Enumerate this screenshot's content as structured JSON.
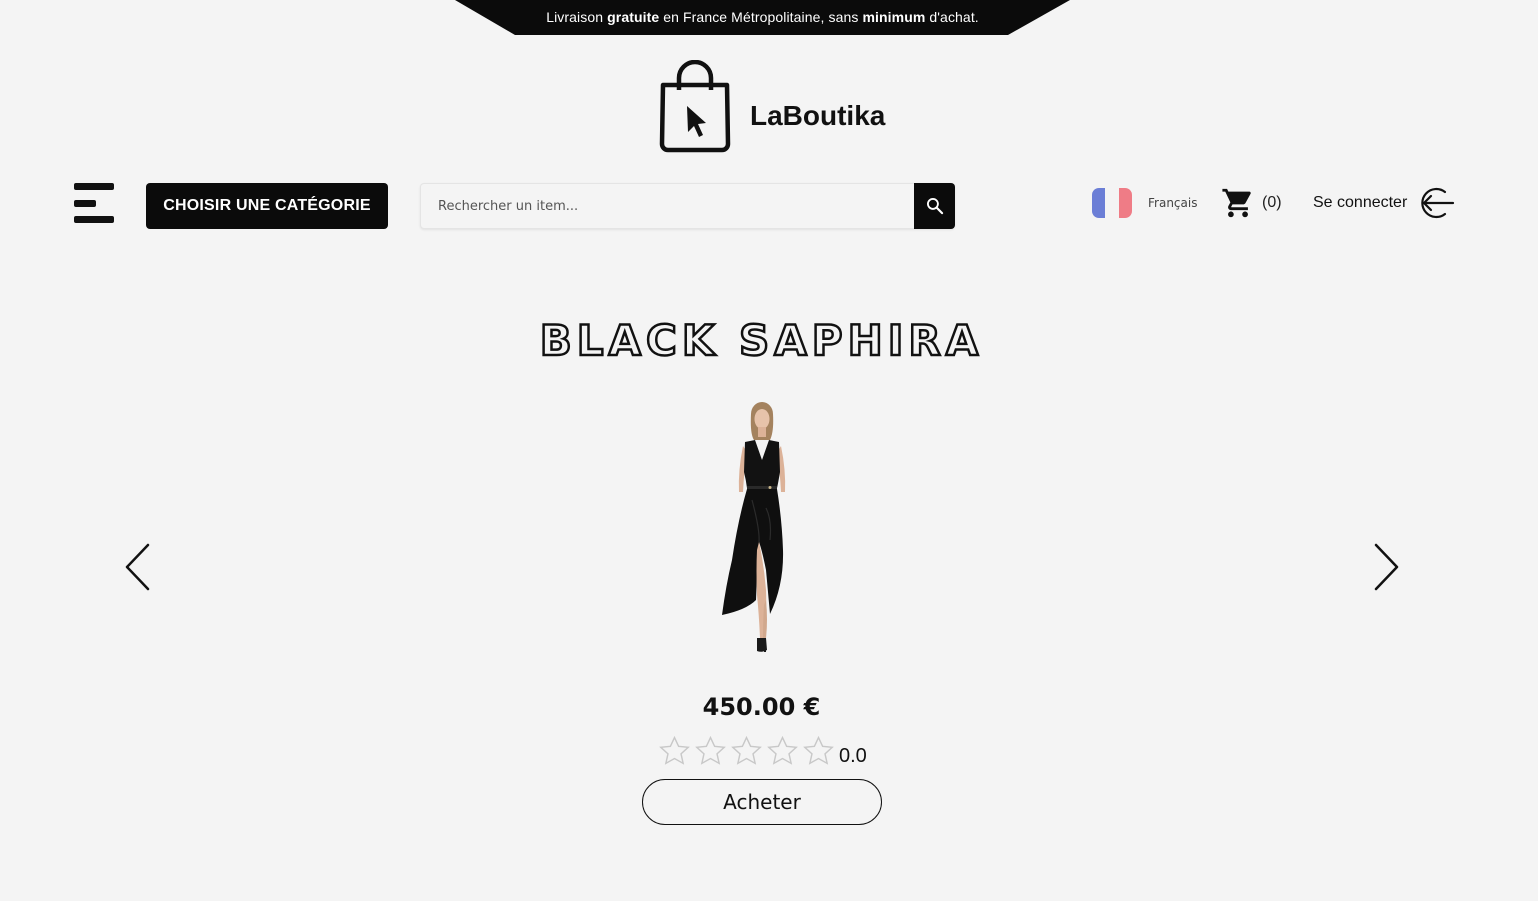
{
  "banner": {
    "part1": "Livraison ",
    "bold1": "gratuite",
    "part2": " en France Métropolitaine, sans ",
    "bold2": "minimum",
    "part3": " d'achat."
  },
  "logo": {
    "name": "LaBoutika",
    "icon": "shopping-bag-cursor-icon"
  },
  "nav": {
    "menu_icon": "hamburger-menu-icon",
    "category_label": "CHOISIR UNE CATÉGORIE",
    "search_placeholder": "Rechercher un item...",
    "search_value": "",
    "search_icon": "search-icon",
    "language_label": "Français",
    "flag_colors": [
      "#6b7ed6",
      "#f4f4f4",
      "#ef7c86"
    ],
    "cart_icon": "cart-icon",
    "cart_count": "(0)",
    "login_label": "Se connecter",
    "login_icon": "sign-in-icon"
  },
  "product": {
    "name": "BLACK SAPHIRA",
    "image": "black-dress-model",
    "price": "450.00 €",
    "rating_value": "0.0",
    "rating_stars": 0,
    "rating_max": 5,
    "buy_label": "Acheter"
  },
  "carousel": {
    "prev_icon": "chevron-left-icon",
    "next_icon": "chevron-right-icon"
  },
  "colors": {
    "background": "#f4f4f4",
    "dark": "#0b0b0b",
    "star_empty": "#c8c8c8"
  }
}
